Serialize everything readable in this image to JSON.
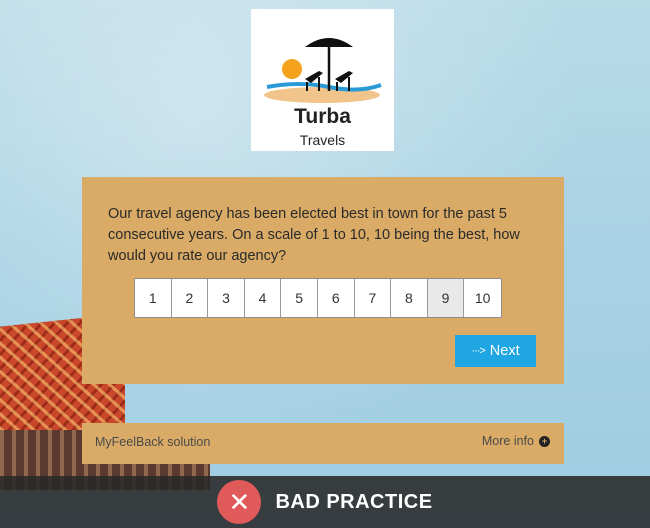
{
  "logo": {
    "title": "Turba",
    "subtitle": "Travels",
    "icon": "beach-umbrella-logo"
  },
  "survey": {
    "question": "Our travel agency has been elected best in town for the past 5 consecutive years. On a scale of 1 to 10, 10 being the best, how would you rate our agency?",
    "scale": [
      "1",
      "2",
      "3",
      "4",
      "5",
      "6",
      "7",
      "8",
      "9",
      "10"
    ],
    "selected": "9",
    "next_label": "Next",
    "next_icon": "dots-arrow-icon"
  },
  "footer": {
    "solution_label": "MyFeelBack solution",
    "more_info_label": "More info",
    "more_info_icon": "plus-circle-icon"
  },
  "banner": {
    "label": "BAD PRACTICE",
    "icon": "close-icon",
    "accent_color": "#e05a5a"
  },
  "colors": {
    "card": "#d9ab67",
    "button": "#1fa6e3"
  }
}
